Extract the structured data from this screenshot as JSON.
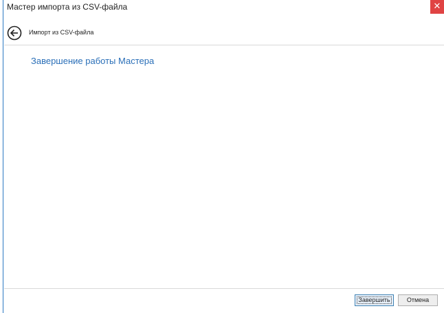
{
  "window": {
    "title": "Мастер импорта из CSV-файла",
    "close_glyph": "✕",
    "close_color": "#e04343"
  },
  "nav": {
    "back_icon": "back-arrow-circle-icon",
    "title": "Импорт из CSV-файла"
  },
  "main": {
    "heading": "Завершение работы Мастера",
    "heading_color": "#2a6fb8"
  },
  "footer": {
    "finish_label": "Завершить",
    "cancel_label": "Отмена"
  }
}
